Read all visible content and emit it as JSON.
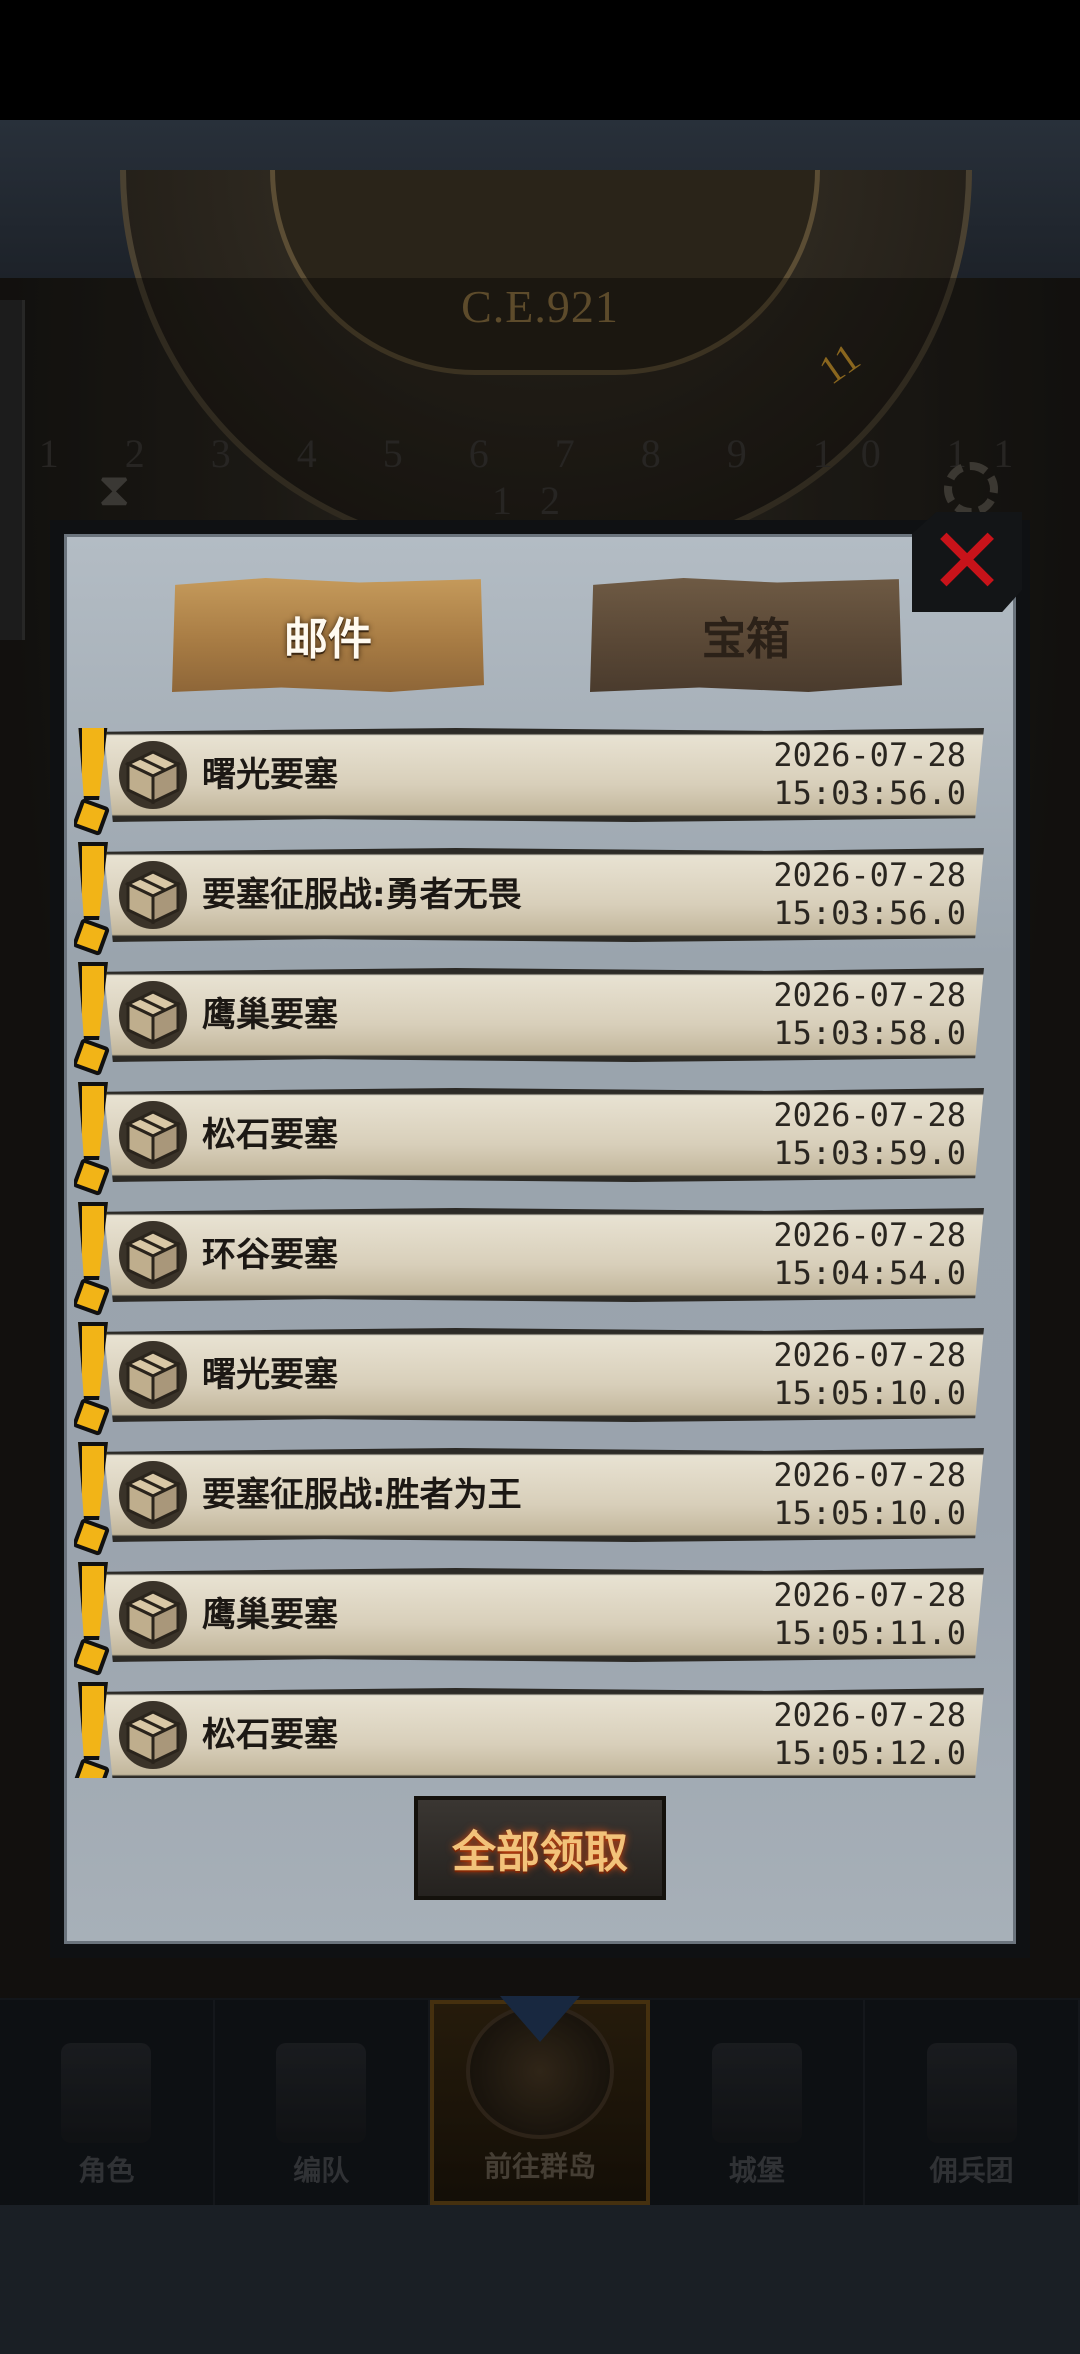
{
  "background": {
    "era": "C.E.921",
    "dial_numbers": "1 2 3 4 5 6 7 8 9 10 11 12",
    "current_marker": "11"
  },
  "modal": {
    "tabs": [
      {
        "label": "邮件",
        "active": true
      },
      {
        "label": "宝箱",
        "active": false
      }
    ],
    "close_icon": "close-x-icon",
    "mails": [
      {
        "title": "曙光要塞",
        "date": "2026-07-28",
        "time": "15:03:56.0"
      },
      {
        "title": "要塞征服战:勇者无畏",
        "date": "2026-07-28",
        "time": "15:03:56.0"
      },
      {
        "title": "鹰巢要塞",
        "date": "2026-07-28",
        "time": "15:03:58.0"
      },
      {
        "title": "松石要塞",
        "date": "2026-07-28",
        "time": "15:03:59.0"
      },
      {
        "title": "环谷要塞",
        "date": "2026-07-28",
        "time": "15:04:54.0"
      },
      {
        "title": "曙光要塞",
        "date": "2026-07-28",
        "time": "15:05:10.0"
      },
      {
        "title": "要塞征服战:胜者为王",
        "date": "2026-07-28",
        "time": "15:05:10.0"
      },
      {
        "title": "鹰巢要塞",
        "date": "2026-07-28",
        "time": "15:05:11.0"
      },
      {
        "title": "松石要塞",
        "date": "2026-07-28",
        "time": "15:05:12.0"
      }
    ],
    "claim_all_label": "全部领取"
  },
  "nav": {
    "items": [
      {
        "label": "角色",
        "icon": "knight-icon",
        "active": false
      },
      {
        "label": "编队",
        "icon": "helmet-icon",
        "active": false
      },
      {
        "label": "前往群岛",
        "icon": "island-map-icon",
        "active": true
      },
      {
        "label": "城堡",
        "icon": "castle-icon",
        "active": false
      },
      {
        "label": "佣兵团",
        "icon": "mercenary-icon",
        "active": false
      }
    ]
  },
  "colors": {
    "alert": "#f2b417",
    "close": "#c8131a",
    "tab_active": "#c59a5b",
    "claim_text": "#f2c27a"
  }
}
